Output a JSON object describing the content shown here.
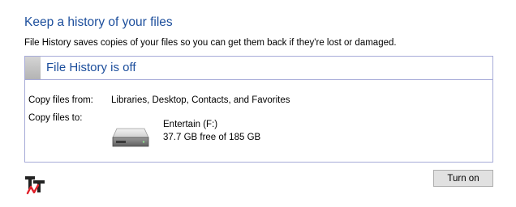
{
  "header": {
    "title": "Keep a history of your files",
    "description": "File History saves copies of your files so you can get them back if they're lost or damaged."
  },
  "status_panel": {
    "title": "File History is off",
    "copy_from_label": "Copy files from:",
    "copy_from_value": "Libraries, Desktop, Contacts, and Favorites",
    "copy_to_label": "Copy files to:",
    "drive": {
      "icon": "drive-icon",
      "name": "Entertain (F:)",
      "free_space": "37.7 GB free of 185 GB"
    }
  },
  "actions": {
    "turn_on_label": "Turn on"
  },
  "colors": {
    "accent_text": "#1c4e9c",
    "panel_border": "#a7abd8",
    "button_bg": "#e1e1e1",
    "logo_red": "#e0202a"
  }
}
